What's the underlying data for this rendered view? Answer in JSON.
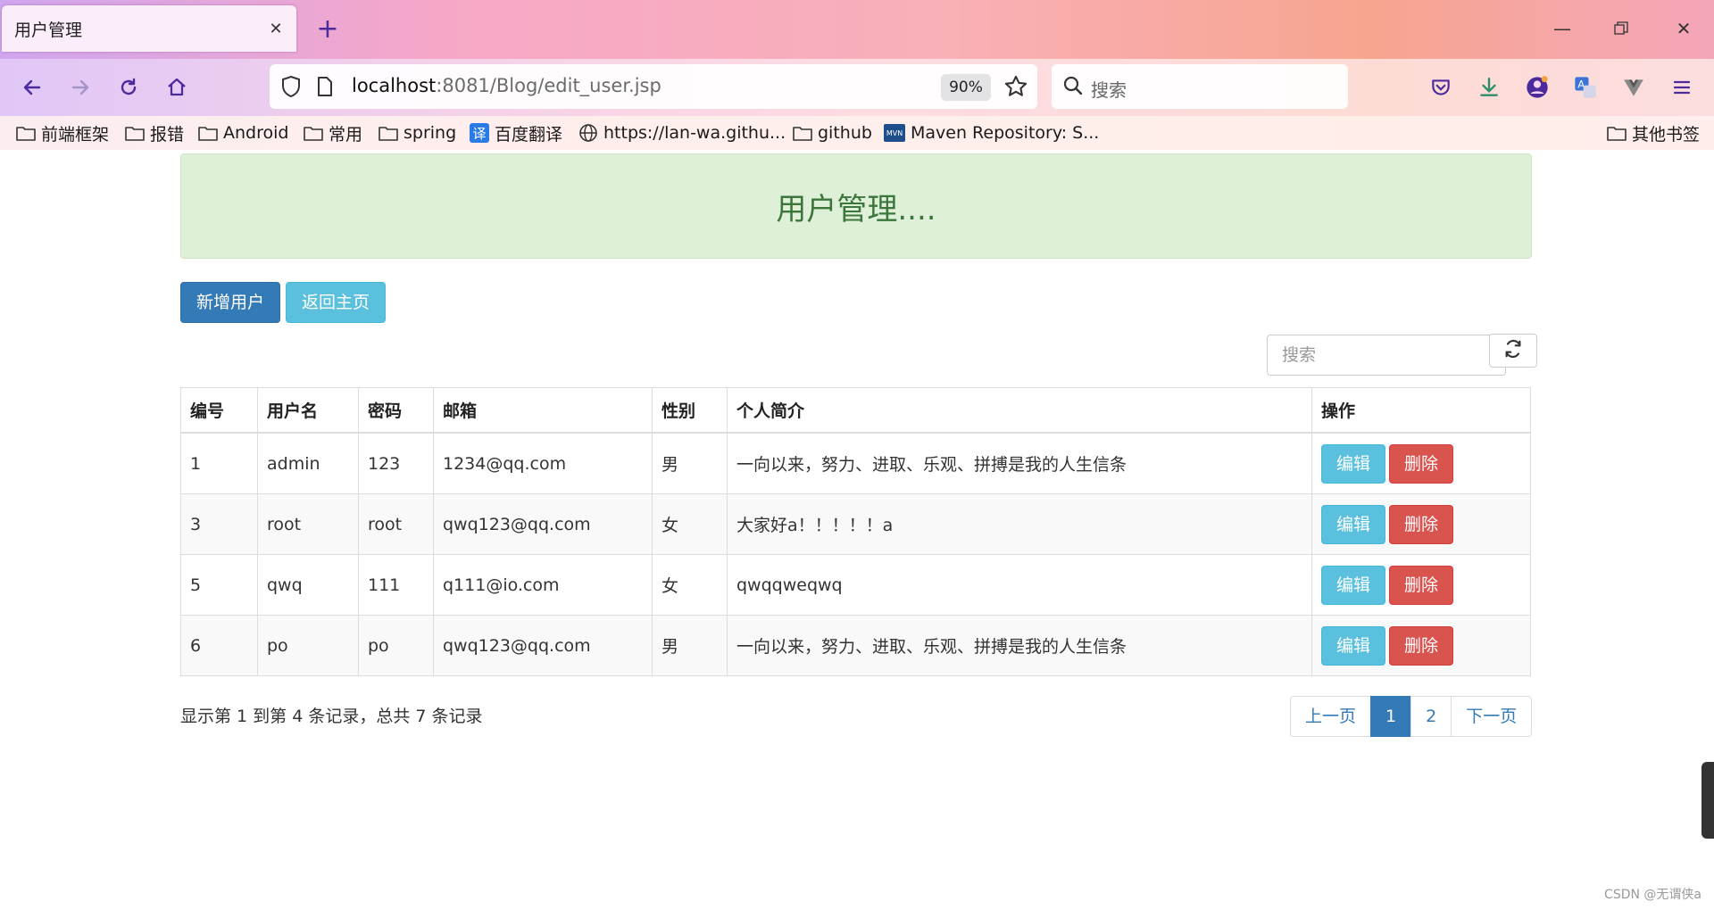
{
  "browser": {
    "tab_title": "用户管理",
    "url_host": "localhost",
    "url_path": ":8081/Blog/edit_user.jsp",
    "zoom": "90%",
    "search_placeholder": "搜索",
    "bookmarks": [
      {
        "label": "前端框架",
        "icon": "folder-icon"
      },
      {
        "label": "报错",
        "icon": "folder-icon"
      },
      {
        "label": "Android",
        "icon": "folder-icon"
      },
      {
        "label": "常用",
        "icon": "folder-icon"
      },
      {
        "label": "spring",
        "icon": "folder-icon"
      },
      {
        "label": "百度翻译",
        "icon": "translate-icon"
      },
      {
        "label": "https://lan-wa.githu...",
        "icon": "globe-icon"
      },
      {
        "label": "github",
        "icon": "folder-icon"
      },
      {
        "label": "Maven Repository: S...",
        "icon": "maven-icon"
      }
    ],
    "other_bookmarks": "其他书签",
    "translate_badge": "译",
    "maven_badge": "MVN"
  },
  "page": {
    "header_title": "用户管理....",
    "add_user_label": "新增用户",
    "back_home_label": "返回主页",
    "search_placeholder": "搜索",
    "table": {
      "columns": [
        "编号",
        "用户名",
        "密码",
        "邮箱",
        "性别",
        "个人简介",
        "操作"
      ],
      "rows": [
        {
          "id": "1",
          "username": "admin",
          "password": "123",
          "email": "1234@qq.com",
          "gender": "男",
          "bio": "一向以来，努力、进取、乐观、拼搏是我的人生信条"
        },
        {
          "id": "3",
          "username": "root",
          "password": "root",
          "email": "qwq123@qq.com",
          "gender": "女",
          "bio": "大家好a！！！！！a"
        },
        {
          "id": "5",
          "username": "qwq",
          "password": "111",
          "email": "q111@io.com",
          "gender": "女",
          "bio": "qwqqweqwq"
        },
        {
          "id": "6",
          "username": "po",
          "password": "po",
          "email": "qwq123@qq.com",
          "gender": "男",
          "bio": "一向以来，努力、进取、乐观、拼搏是我的人生信条"
        }
      ],
      "edit_label": "编辑",
      "delete_label": "删除"
    },
    "footer_info": "显示第 1 到第 4 条记录，总共 7 条记录",
    "pagination": {
      "prev": "上一页",
      "pages": [
        "1",
        "2"
      ],
      "active": "1",
      "next": "下一页"
    },
    "watermark": "CSDN @无谓侠a"
  },
  "colors": {
    "primary": "#337ab7",
    "info": "#5bc0de",
    "danger": "#d9534f",
    "alert_bg": "#dff0d8",
    "alert_text": "#3c763d"
  }
}
